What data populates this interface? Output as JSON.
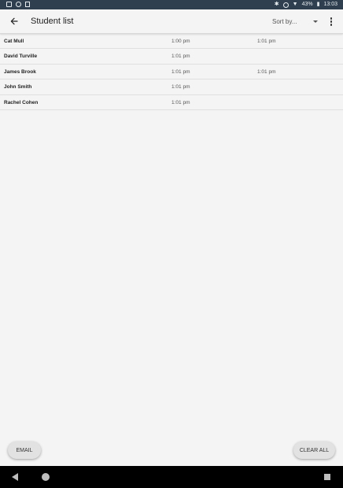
{
  "status_bar": {
    "battery": "43%",
    "time": "13:03"
  },
  "app_bar": {
    "title": "Student list",
    "sort_label": "Sort by..."
  },
  "students": [
    {
      "name": "Cat Mull",
      "time1": "1:00 pm",
      "time2": "1:01 pm"
    },
    {
      "name": "David Turville",
      "time1": "1:01 pm",
      "time2": ""
    },
    {
      "name": "James Brook",
      "time1": "1:01 pm",
      "time2": "1:01 pm"
    },
    {
      "name": "John Smith",
      "time1": "1:01 pm",
      "time2": ""
    },
    {
      "name": "Rachel Cohen",
      "time1": "1:01 pm",
      "time2": ""
    }
  ],
  "buttons": {
    "email": "EMAIL",
    "clear_all": "CLEAR ALL"
  }
}
